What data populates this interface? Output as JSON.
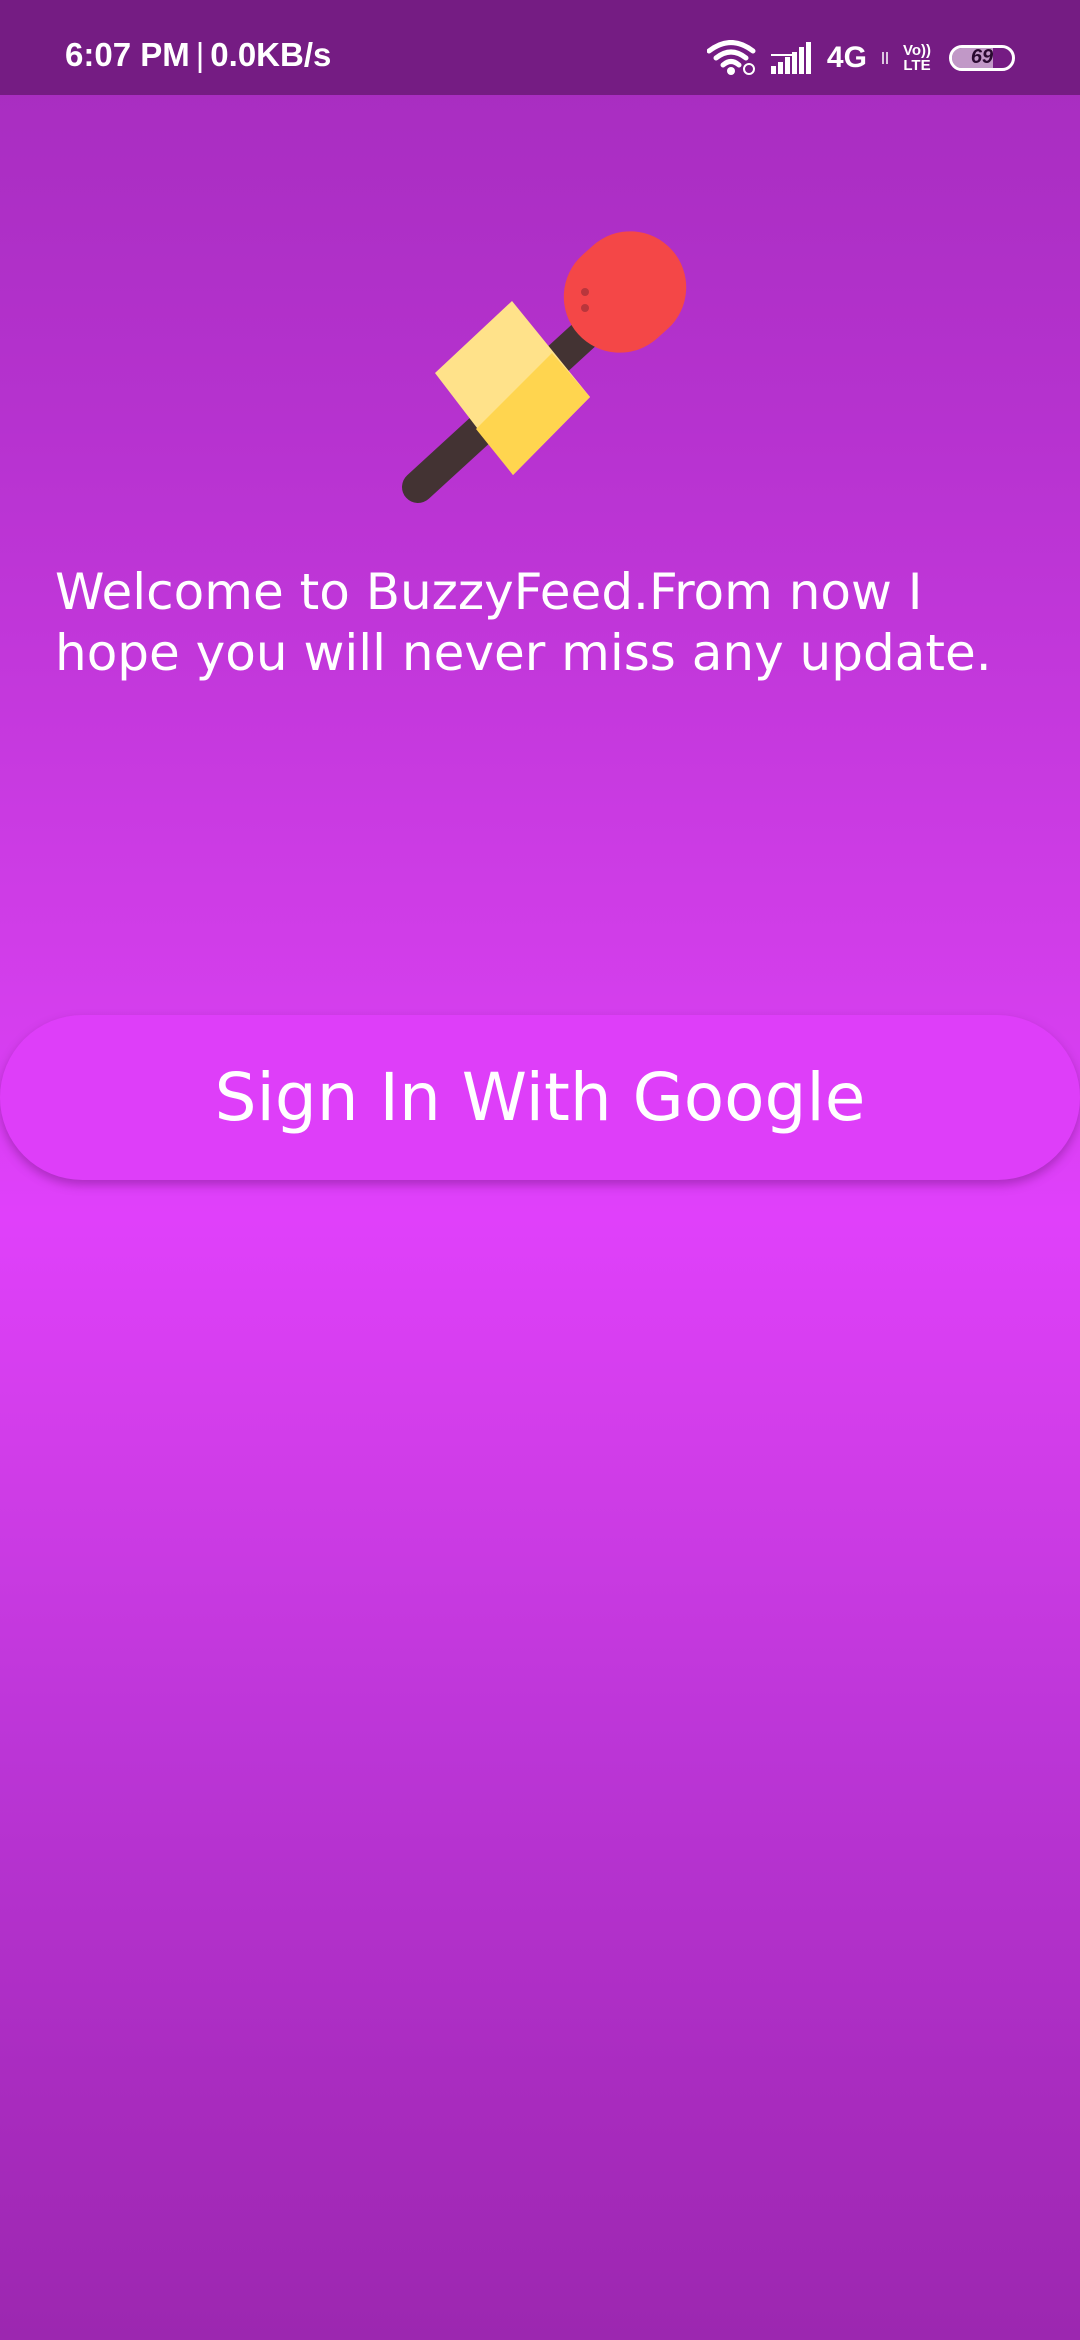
{
  "status_bar": {
    "time": "6:07 PM",
    "separator": "|",
    "data_speed": "0.0KB/s",
    "network_type": "4G",
    "volte_top": "Vo))",
    "volte_bottom": "LTE",
    "battery_level": "69",
    "icons": [
      "wifi-icon",
      "signal-icon",
      "data-arrows-icon",
      "battery-icon"
    ]
  },
  "logo": {
    "icon": "microphone-icon",
    "colors": {
      "head": "#f44747",
      "handle": "#433333",
      "flag_light": "#ffe28a",
      "flag_dark": "#ffd54f"
    }
  },
  "welcome": {
    "text": "Welcome to BuzzyFeed.From now I hope you will never miss any update."
  },
  "sign_in": {
    "label": "Sign In With Google",
    "color": "#de3ef9"
  },
  "theme": {
    "background_top": "#a52cbd",
    "background_mid": "#e040fb",
    "status_bar": "#751c83"
  }
}
